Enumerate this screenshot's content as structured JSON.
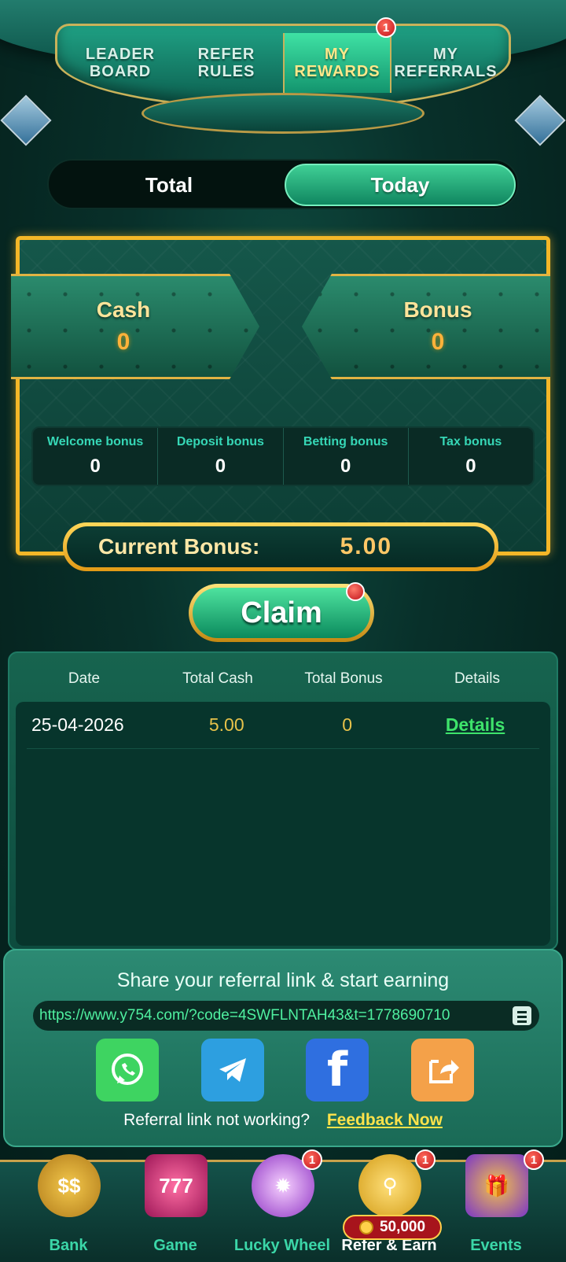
{
  "tabs": [
    {
      "label": "LEADER\nBOARD",
      "active": false
    },
    {
      "label": "REFER\nRULES",
      "active": false
    },
    {
      "label": "MY\nREWARDS",
      "active": true,
      "badge": "1"
    },
    {
      "label": "MY\nREFERRALS",
      "active": false
    }
  ],
  "period_toggle": {
    "total": "Total",
    "today": "Today",
    "selected": "Today"
  },
  "summary": {
    "cash_label": "Cash",
    "cash_value": "0",
    "bonus_label": "Bonus",
    "bonus_value": "0"
  },
  "bonus_breakdown": [
    {
      "name": "Welcome bonus",
      "value": "0"
    },
    {
      "name": "Deposit bonus",
      "value": "0"
    },
    {
      "name": "Betting bonus",
      "value": "0"
    },
    {
      "name": "Tax bonus",
      "value": "0"
    }
  ],
  "current_bonus": {
    "label": "Current Bonus:",
    "value": "5.00"
  },
  "claim_label": "Claim",
  "table": {
    "headers": [
      "Date",
      "Total Cash",
      "Total Bonus",
      "Details"
    ],
    "rows": [
      {
        "date": "25-04-2026",
        "total_cash": "5.00",
        "total_bonus": "0",
        "details": "Details"
      }
    ]
  },
  "share": {
    "title": "Share your referral link & start earning",
    "link": "https://www.y754.com/?code=4SWFLNTAH43&t=1778690710",
    "note": "Referral link not working?",
    "feedback": "Feedback Now"
  },
  "bottom_nav": [
    {
      "label": "Bank",
      "icon": "bank-icon"
    },
    {
      "label": "Game",
      "icon": "slot-machine-icon"
    },
    {
      "label": "Lucky Wheel",
      "icon": "lucky-wheel-icon",
      "badge": "1"
    },
    {
      "label": "Refer & Earn",
      "icon": "refer-earn-icon",
      "badge": "1",
      "active": true
    },
    {
      "label": "Events",
      "icon": "gift-icon",
      "badge": "1"
    }
  ],
  "refer_reward": "50,000",
  "colors": {
    "accent_green": "#13946e",
    "gold": "#f4b728",
    "link_green": "#3ee36b",
    "feedback_yellow": "#ffe34a"
  }
}
